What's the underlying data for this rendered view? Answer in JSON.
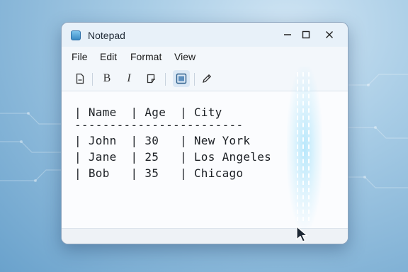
{
  "window": {
    "title": "Notepad"
  },
  "controls": {
    "minimize": "—",
    "maximize": "▢",
    "close": "✕"
  },
  "menu": {
    "items": [
      "File",
      "Edit",
      "Format",
      "View"
    ]
  },
  "toolbar": {
    "buttons": [
      {
        "icon": "new-document-icon"
      },
      {
        "icon": "bold-icon",
        "glyph": "B"
      },
      {
        "icon": "italic-icon",
        "glyph": "I"
      },
      {
        "icon": "paste-icon"
      },
      {
        "icon": "table-view-icon",
        "active": true
      },
      {
        "icon": "pen-icon"
      }
    ]
  },
  "editor": {
    "lines": [
      "| Name  | Age  | City",
      "------------------------",
      "| John  | 30   | New York",
      "| Jane  | 25   | Los Angeles",
      "| Bob   | 35   | Chicago"
    ]
  },
  "colors": {
    "accent": "#2d6fa8",
    "window_bg": "#f7f9fc",
    "glow": "#82d7fa"
  }
}
